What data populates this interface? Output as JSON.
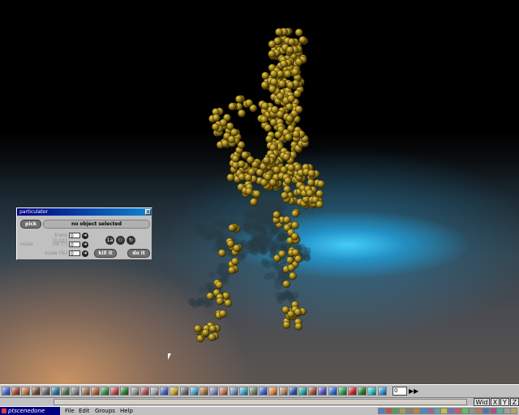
{
  "window": {
    "title": "particulator",
    "close_label": "x"
  },
  "dialog": {
    "pick_label": "pick",
    "status_text": "no object selected",
    "section_label": "noise",
    "params": [
      {
        "label": "trans (0,01)",
        "value": "0"
      },
      {
        "label": "rot (°)",
        "value": "0"
      },
      {
        "label": "scale (%)",
        "value": "0"
      }
    ],
    "action_icons": [
      "1a",
      "⚇",
      "↻"
    ],
    "kill_label": "kill it",
    "do_label": "do it"
  },
  "toolbar": {
    "field_value": "0",
    "ff_label": "▶▶",
    "colors": [
      "#3a5fcd",
      "#a04030",
      "#c07030",
      "#704020",
      "#606060",
      "#2070a0",
      "#507050",
      "#808080",
      "#9a7050",
      "#b06030",
      "#3a8a3a",
      "#c04040",
      "#2a7a2a",
      "#909090",
      "#b05050",
      "#a0a0a0",
      "#4060c0",
      "#d0a020",
      "#6a6a6a",
      "#40a0d0",
      "#a07030",
      "#8080c0",
      "#c07050",
      "#6a8ab0",
      "#30a0c0",
      "#608060",
      "#3060d0",
      "#e08030",
      "#b08060",
      "#2050b0",
      "#20a0a0",
      "#a05030",
      "#5050c0",
      "#2a6ad0",
      "#20a040",
      "#d02020",
      "#207a20",
      "#20c0c0",
      "#2a90d0"
    ]
  },
  "statusbar": {
    "wid_label": "Wid",
    "axes": [
      "X",
      "Y",
      "Z"
    ]
  },
  "menubar": {
    "app_name": "ptscenedone",
    "menus": [
      "File",
      "Edit",
      "Groups",
      "Help"
    ]
  }
}
